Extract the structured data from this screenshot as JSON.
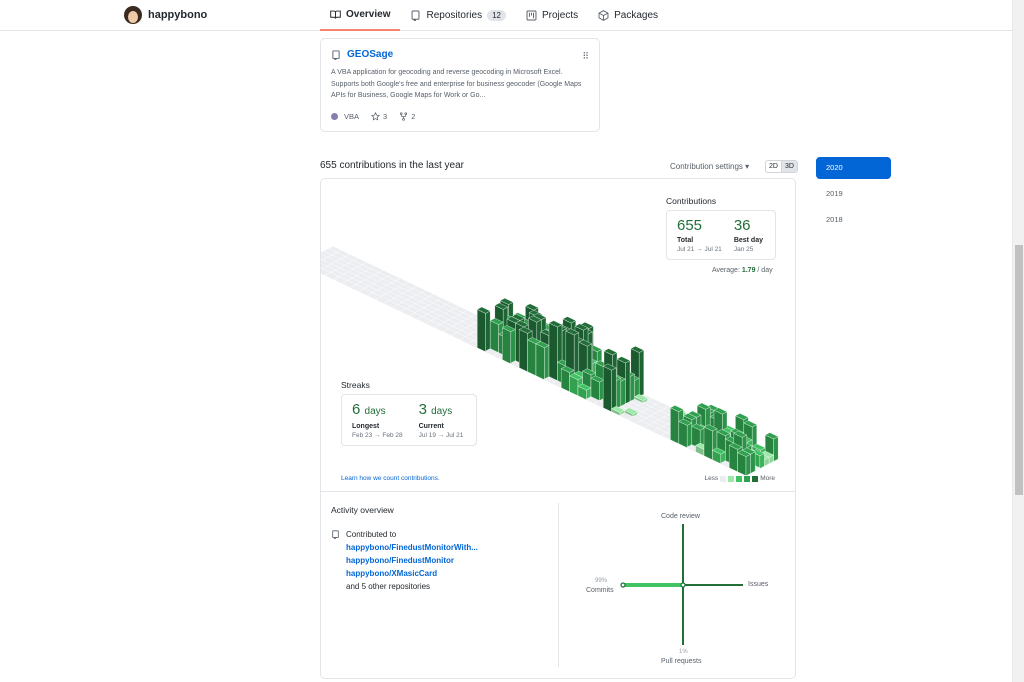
{
  "user": {
    "name": "happybono"
  },
  "nav": {
    "tabs": [
      {
        "label": "Overview",
        "active": true,
        "icon": "book-icon"
      },
      {
        "label": "Repositories",
        "count": "12",
        "icon": "repo-icon"
      },
      {
        "label": "Projects",
        "icon": "project-icon"
      },
      {
        "label": "Packages",
        "icon": "package-icon"
      }
    ]
  },
  "pinned": {
    "name": "GEOSage",
    "description": "A VBA application for geocoding and reverse geocoding in Microsoft Excel. Supports both Google's free and enterprise for business geocoder (Google Maps APIs for Business, Google Maps for Work or Go...",
    "language": "VBA",
    "language_color": "#867db1",
    "stars": "3",
    "forks": "2"
  },
  "contributions": {
    "heading": "655 contributions in the last year",
    "settings_label": "Contribution settings ▾",
    "toggle_2d": "2D",
    "toggle_3d": "3D",
    "years": [
      "2020",
      "2019",
      "2018"
    ],
    "stats": {
      "title": "Contributions",
      "total": "655",
      "total_label": "Total",
      "total_range": "Jul 21 → Jul 21",
      "best": "36",
      "best_label": "Best day",
      "best_date": "Jan 25",
      "average_prefix": "Average: ",
      "average_value": "1.79",
      "average_suffix": " / day"
    },
    "streaks": {
      "title": "Streaks",
      "longest": "6",
      "longest_unit": "days",
      "longest_label": "Longest",
      "longest_range": "Feb 23 → Feb 28",
      "current": "3",
      "current_unit": "days",
      "current_label": "Current",
      "current_range": "Jul 19 → Jul 21"
    },
    "learn_link": "Learn how we count contributions.",
    "legend_less": "Less",
    "legend_more": "More",
    "colors": [
      "#ebedf0",
      "#9be9a8",
      "#40c463",
      "#30a14e",
      "#216e39"
    ]
  },
  "activity": {
    "title": "Activity overview",
    "contributed_to": "Contributed to",
    "repos": [
      "happybono/FinedustMonitorWith...",
      "happybono/FinedustMonitor",
      "happybono/XMasicCard"
    ],
    "others": "and 5 other repositories",
    "axes": {
      "top": "Code review",
      "right": "Issues",
      "bottom": "Pull requests",
      "left": "Commits",
      "commits_pct": "99%",
      "pr_pct": "1%"
    }
  }
}
